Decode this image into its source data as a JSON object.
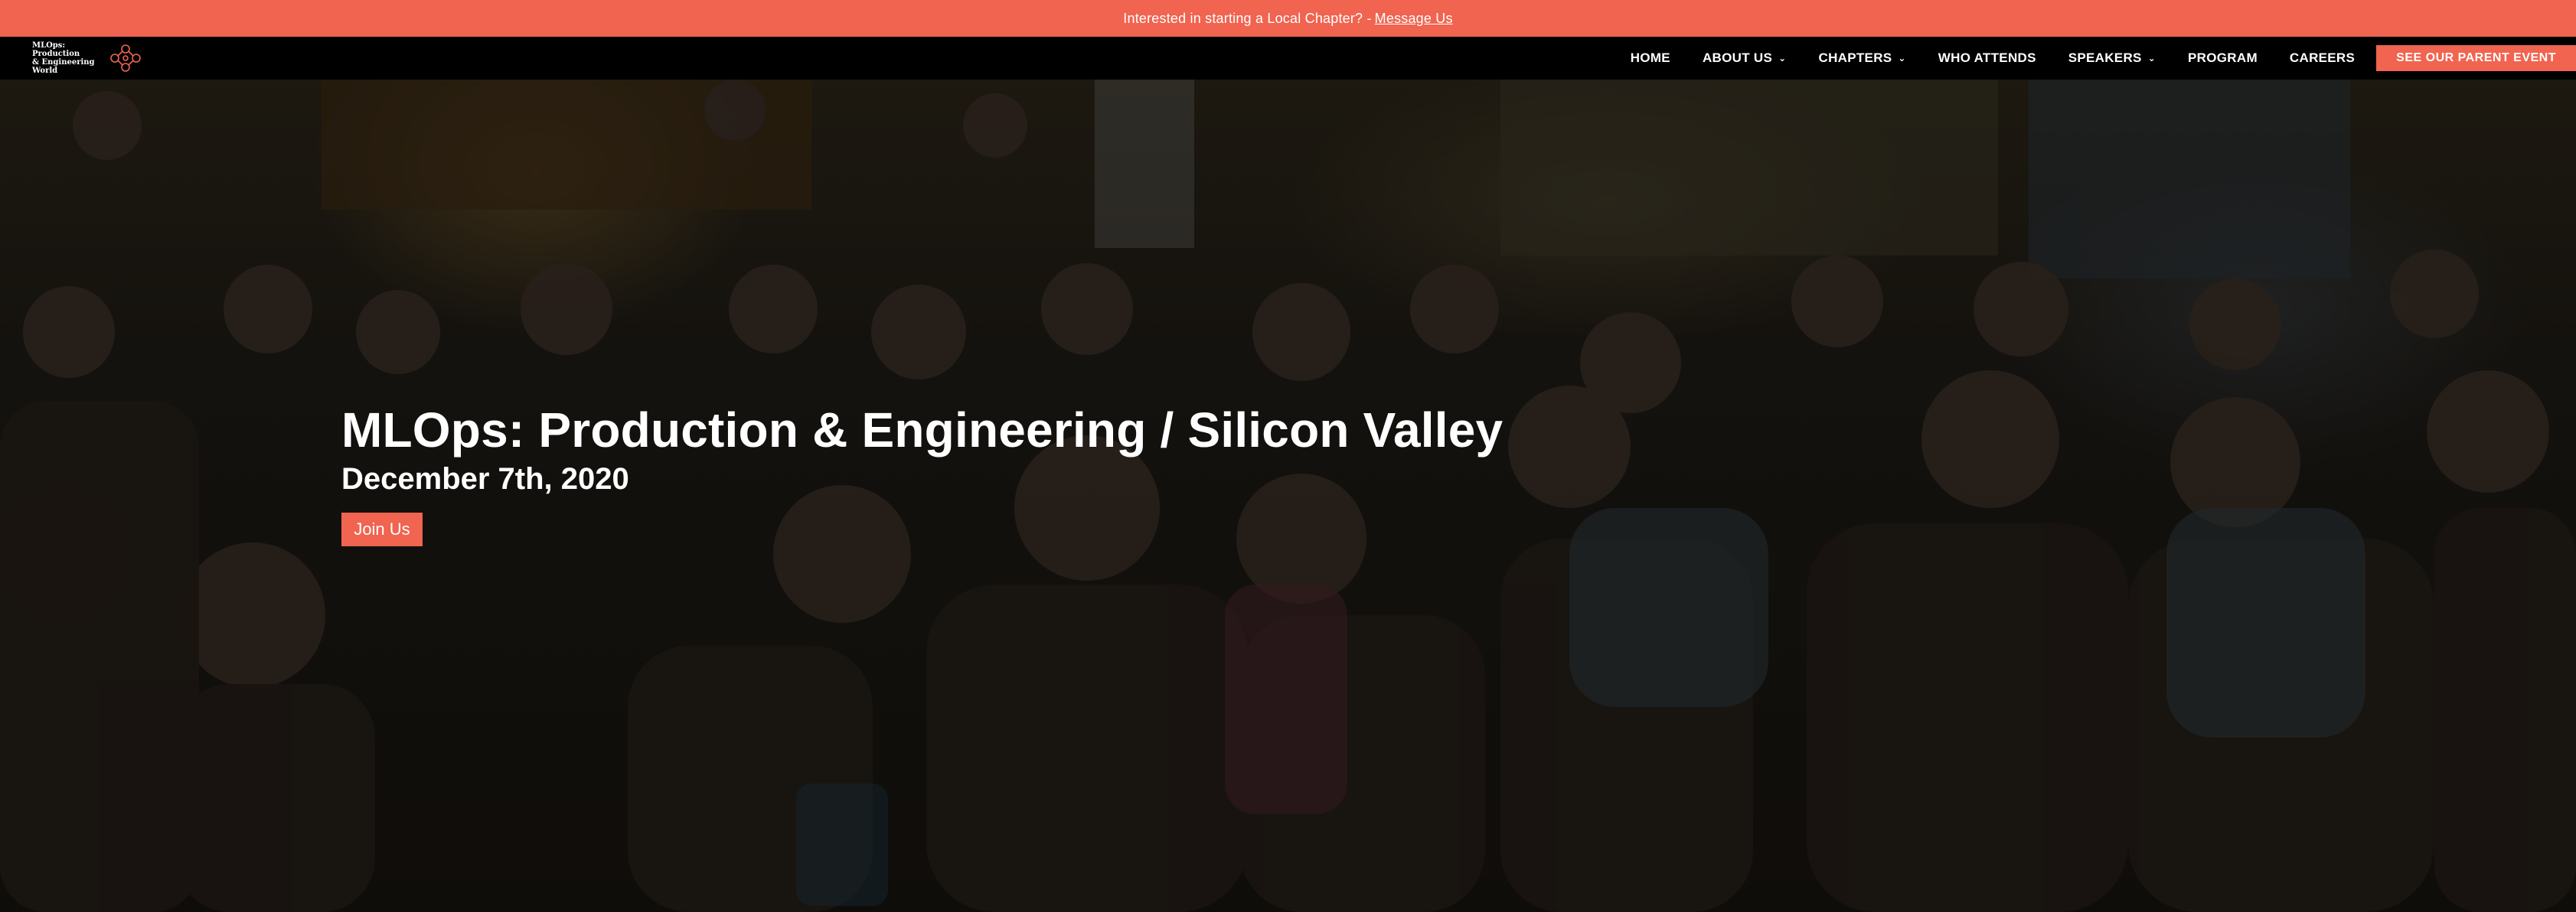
{
  "announcement": {
    "text": "Interested in starting a Local Chapter? -",
    "link_label": "Message Us"
  },
  "logo": {
    "line1": "MLOps: Production",
    "line2": "& Engineering",
    "line3": "World"
  },
  "nav": {
    "items": [
      {
        "label": "HOME",
        "dropdown": false
      },
      {
        "label": "ABOUT US",
        "dropdown": true
      },
      {
        "label": "CHAPTERS",
        "dropdown": true
      },
      {
        "label": "WHO ATTENDS",
        "dropdown": false
      },
      {
        "label": "SPEAKERS",
        "dropdown": true
      },
      {
        "label": "PROGRAM",
        "dropdown": false
      },
      {
        "label": "CAREERS",
        "dropdown": false
      }
    ],
    "cta_label": "SEE OUR PARENT EVENT"
  },
  "hero": {
    "title": "MLOps: Production & Engineering / Silicon Valley",
    "date": "December 7th, 2020",
    "button_label": "Join Us",
    "background_image": "photo of a seated conference audience"
  },
  "colors": {
    "accent": "#f06450",
    "nav_bg": "#000000",
    "text": "#ffffff"
  },
  "icons": {
    "chevron": "chevron-down-icon",
    "logo_mark": "network-node-icon"
  }
}
